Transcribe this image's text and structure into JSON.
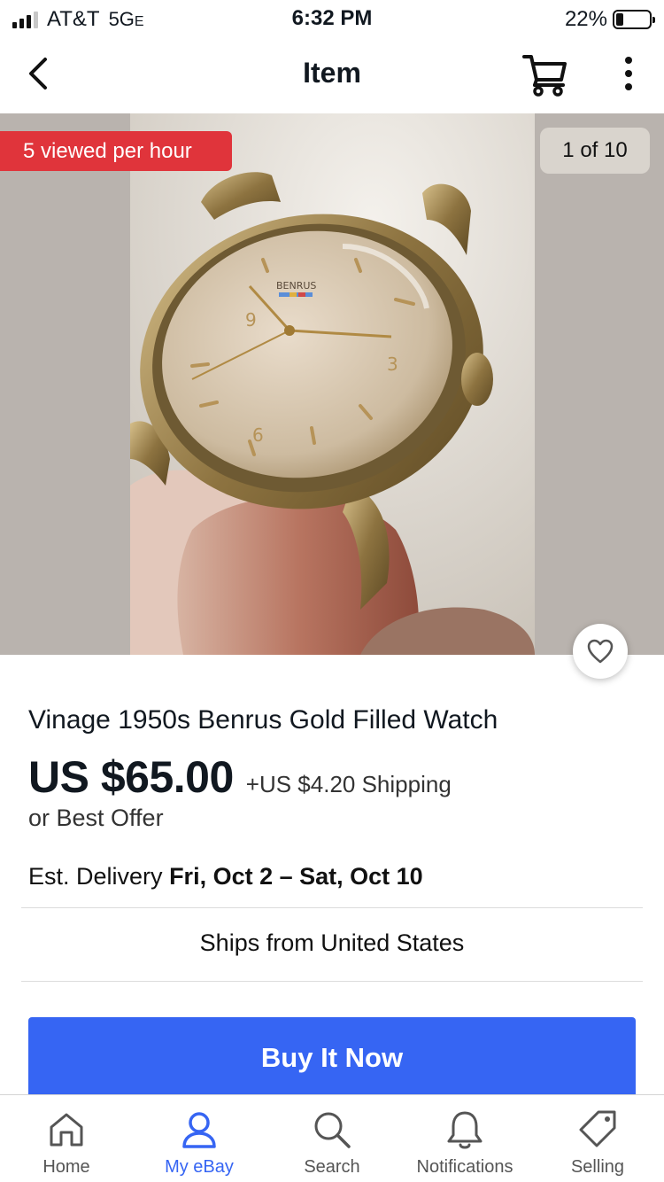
{
  "status_bar": {
    "carrier": "AT&T",
    "network": "5G",
    "network_suffix": "E",
    "time": "6:32 PM",
    "battery": "22%",
    "battery_level": 0.22
  },
  "nav": {
    "title": "Item",
    "icons": [
      "chevron-left-icon",
      "cart-icon",
      "more-vertical-icon"
    ]
  },
  "gallery": {
    "viewed_badge": "5 viewed per hour",
    "image_counter": "1 of 10",
    "badge_color": "#e0343b"
  },
  "listing": {
    "title": "Vinage 1950s Benrus Gold Filled Watch",
    "price": "US $65.00",
    "shipping": "+US $4.20 Shipping",
    "offer": "or Best Offer",
    "delivery_label": "Est. Delivery",
    "delivery_dates": "Fri, Oct 2 – Sat, Oct 10",
    "ships_from": "Ships from United States"
  },
  "actions": {
    "buy_now": "Buy It Now",
    "accent_color": "#3665f3"
  },
  "tabs": [
    {
      "label": "Home",
      "icon": "home-icon",
      "active": false
    },
    {
      "label": "My eBay",
      "icon": "user-icon",
      "active": true
    },
    {
      "label": "Search",
      "icon": "search-icon",
      "active": false
    },
    {
      "label": "Notifications",
      "icon": "bell-icon",
      "active": false
    },
    {
      "label": "Selling",
      "icon": "tag-icon",
      "active": false
    }
  ]
}
